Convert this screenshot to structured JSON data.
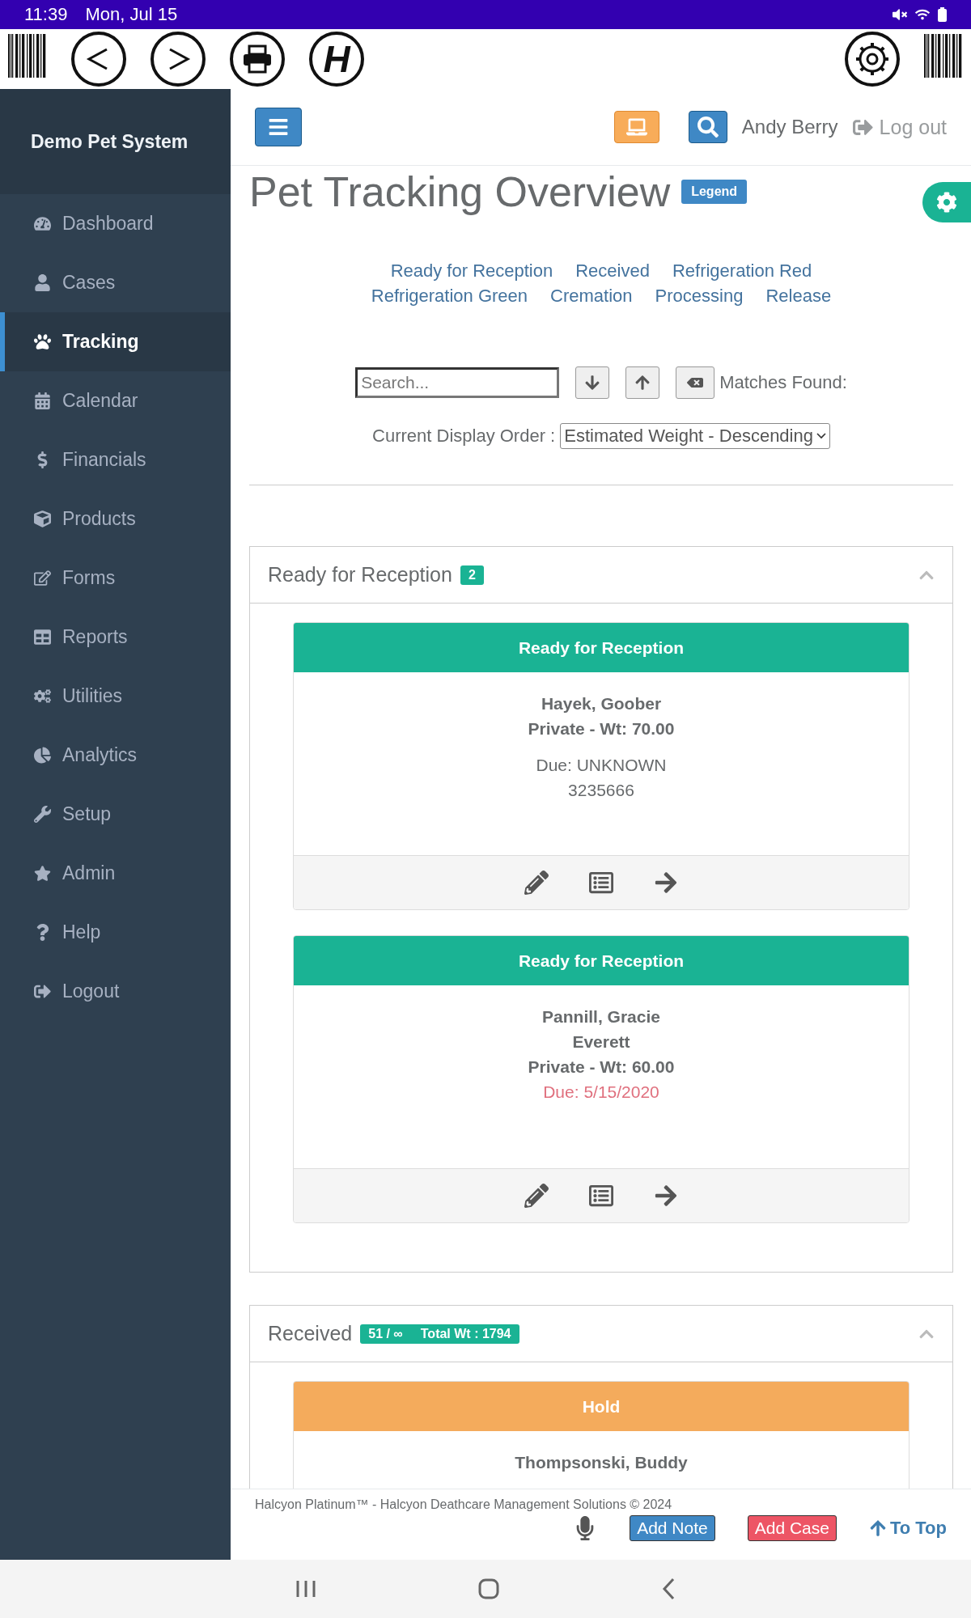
{
  "status_bar": {
    "time": "11:39",
    "date": "Mon, Jul 15"
  },
  "toolbar": {
    "logo": "H"
  },
  "sidebar": {
    "brand": "Demo Pet System",
    "items": [
      {
        "label": "Dashboard",
        "selected": false
      },
      {
        "label": "Cases",
        "selected": false
      },
      {
        "label": "Tracking",
        "selected": true
      },
      {
        "label": "Calendar",
        "selected": false
      },
      {
        "label": "Financials",
        "selected": false
      },
      {
        "label": "Products",
        "selected": false
      },
      {
        "label": "Forms",
        "selected": false
      },
      {
        "label": "Reports",
        "selected": false
      },
      {
        "label": "Utilities",
        "selected": false
      },
      {
        "label": "Analytics",
        "selected": false
      },
      {
        "label": "Setup",
        "selected": false
      },
      {
        "label": "Admin",
        "selected": false
      },
      {
        "label": "Help",
        "selected": false
      },
      {
        "label": "Logout",
        "selected": false
      }
    ]
  },
  "header": {
    "user": "Andy Berry",
    "logout": "Log out"
  },
  "page": {
    "title": "Pet Tracking Overview",
    "legend": "Legend",
    "status_links": [
      "Ready for Reception",
      "Received",
      "Refrigeration Red",
      "Refrigeration Green",
      "Cremation",
      "Processing",
      "Release"
    ],
    "search": {
      "placeholder": "Search...",
      "matches_label": "Matches Found:"
    },
    "order": {
      "label": "Current Display Order :",
      "value": "Estimated Weight - Descending"
    }
  },
  "sections": [
    {
      "title": "Ready for Reception",
      "badges": [
        "2"
      ],
      "expanded": true,
      "cards": [
        {
          "status": "Ready for Reception",
          "color": "#1ab394",
          "lines": [
            {
              "text": "Hayek, Goober",
              "kind": "bold"
            },
            {
              "text": "Private - Wt: 70.00",
              "kind": "bold"
            },
            {
              "text": "Due: UNKNOWN",
              "kind": "normal"
            },
            {
              "text": "3235666",
              "kind": "normal"
            }
          ]
        },
        {
          "status": "Ready for Reception",
          "color": "#1ab394",
          "lines": [
            {
              "text": "Pannill, Gracie",
              "kind": "bold"
            },
            {
              "text": "Everett",
              "kind": "bold"
            },
            {
              "text": "Private - Wt: 60.00",
              "kind": "bold"
            },
            {
              "text": "Due: 5/15/2020",
              "kind": "overdue"
            }
          ]
        }
      ]
    },
    {
      "title": "Received",
      "badges": [
        "51 / ∞",
        "Total Wt : 1794"
      ],
      "expanded": true,
      "cards": [
        {
          "status": "Hold",
          "color": "#f4ab5c",
          "lines": [
            {
              "text": "Thompsonski, Buddy",
              "kind": "bold"
            }
          ]
        }
      ]
    }
  ],
  "footer": {
    "copyright": "Halcyon Platinum™ - Halcyon Deathcare Management Solutions © 2024",
    "add_note": "Add Note",
    "add_case": "Add Case",
    "to_top": "To Top"
  }
}
